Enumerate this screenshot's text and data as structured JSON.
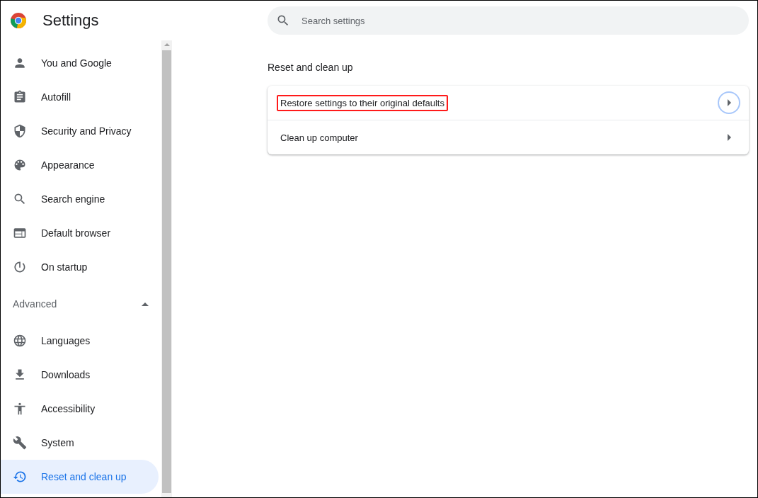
{
  "header": {
    "title": "Settings",
    "search": {
      "placeholder": "Search settings"
    }
  },
  "sidebar": {
    "items": [
      {
        "label": "You and Google",
        "selected": false
      },
      {
        "label": "Autofill",
        "selected": false
      },
      {
        "label": "Security and Privacy",
        "selected": false
      },
      {
        "label": "Appearance",
        "selected": false
      },
      {
        "label": "Search engine",
        "selected": false
      },
      {
        "label": "Default browser",
        "selected": false
      },
      {
        "label": "On startup",
        "selected": false
      }
    ],
    "advanced": {
      "label": "Advanced",
      "expanded": true,
      "items": [
        {
          "label": "Languages",
          "selected": false
        },
        {
          "label": "Downloads",
          "selected": false
        },
        {
          "label": "Accessibility",
          "selected": false
        },
        {
          "label": "System",
          "selected": false
        },
        {
          "label": "Reset and clean up",
          "selected": true
        }
      ]
    }
  },
  "section": {
    "title": "Reset and clean up",
    "rows": [
      {
        "label": "Restore settings to their original defaults",
        "highlighted": true,
        "focused": true
      },
      {
        "label": "Clean up computer",
        "highlighted": false,
        "focused": false
      }
    ]
  }
}
